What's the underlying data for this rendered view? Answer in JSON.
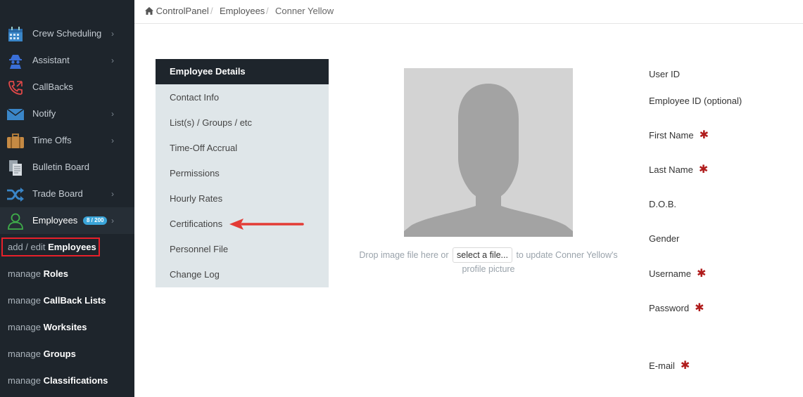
{
  "sidebar": {
    "items": [
      {
        "label": "Crew Scheduling",
        "icon": "calendar-icon",
        "chevron": "›"
      },
      {
        "label": "Assistant",
        "icon": "spy-icon",
        "chevron": "›"
      },
      {
        "label": "CallBacks",
        "icon": "phone-icon"
      },
      {
        "label": "Notify",
        "icon": "envelope-icon",
        "chevron": "›"
      },
      {
        "label": "Time Offs",
        "icon": "suitcase-icon",
        "chevron": "›"
      },
      {
        "label": "Bulletin Board",
        "icon": "documents-icon"
      },
      {
        "label": "Trade Board",
        "icon": "shuffle-icon",
        "chevron": "›"
      },
      {
        "label": "Employees",
        "icon": "user-icon",
        "chevron": "›",
        "badge": "8 / 200"
      }
    ],
    "sub_items": [
      {
        "prefix": "add / edit",
        "bold": "Employees"
      },
      {
        "prefix": "manage",
        "bold": "Roles"
      },
      {
        "prefix": "manage",
        "bold": "CallBack Lists"
      },
      {
        "prefix": "manage",
        "bold": "Worksites"
      },
      {
        "prefix": "manage",
        "bold": "Groups"
      },
      {
        "prefix": "manage",
        "bold": "Classifications"
      }
    ]
  },
  "breadcrumb": {
    "home": "ControlPanel",
    "section": "Employees",
    "current": "Conner Yellow",
    "separator": "/"
  },
  "tabs": {
    "active": "Employee Details",
    "items": [
      "Contact Info",
      "List(s) / Groups / etc",
      "Time-Off Accrual",
      "Permissions",
      "Hourly Rates",
      "Certifications",
      "Personnel File",
      "Change Log"
    ]
  },
  "avatar": {
    "drop_before": "Drop image file here or",
    "select_label": "select a file...",
    "drop_after": "to update Conner Yellow's profile picture"
  },
  "form": {
    "required_mark": "✱",
    "fields": [
      {
        "label": "User ID",
        "required": false
      },
      {
        "label": "Employee ID (optional)",
        "required": false
      },
      {
        "label": "First Name",
        "required": true
      },
      {
        "label": "Last Name",
        "required": true
      },
      {
        "label": "D.O.B.",
        "required": false
      },
      {
        "label": "Gender",
        "required": false
      },
      {
        "label": "Username",
        "required": true
      },
      {
        "label": "Password",
        "required": true
      },
      {
        "label": "E-mail",
        "required": true
      }
    ]
  },
  "colors": {
    "sidebar_bg": "#1e252c",
    "accent_badge": "#3aa4d8",
    "highlight_red": "#e8202a",
    "required_red": "#b01c1c"
  }
}
